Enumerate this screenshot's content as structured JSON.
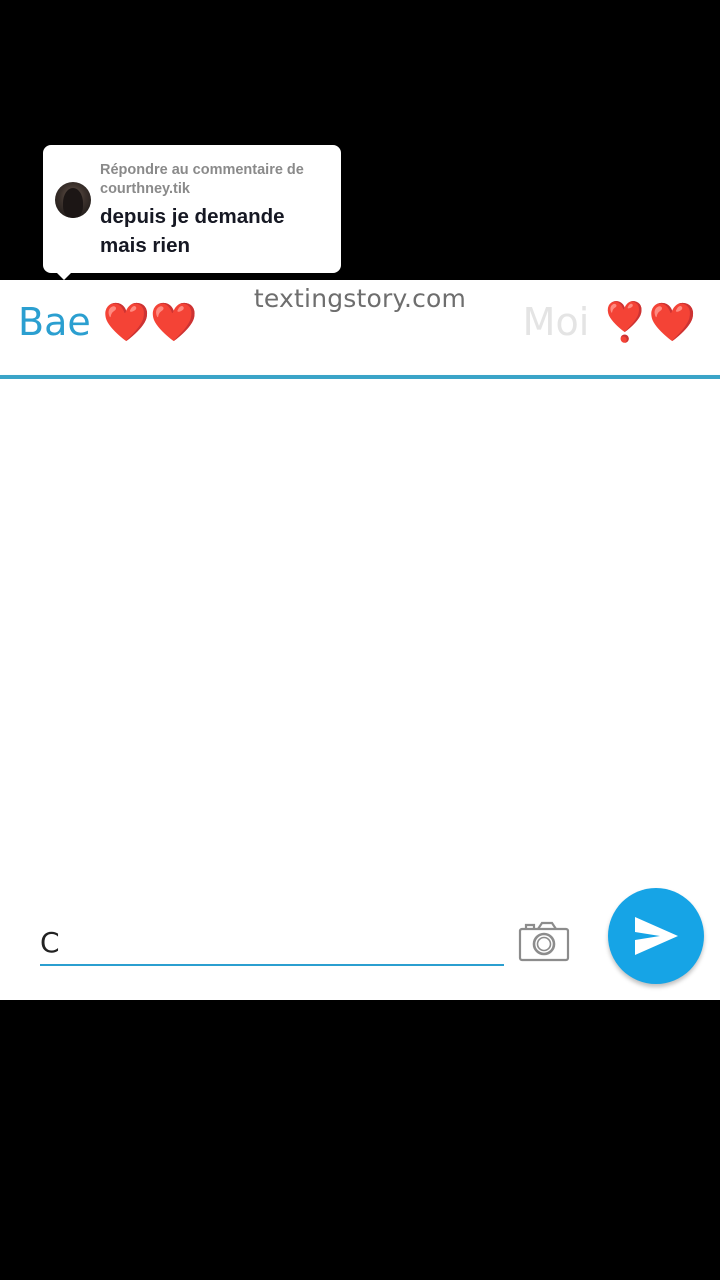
{
  "reply": {
    "header": "Répondre au commentaire de courthney.tik",
    "comment": "depuis je demande mais rien"
  },
  "chat": {
    "watermark": "textingstory.com",
    "contact_left_name": "Bae",
    "contact_left_emoji": "❤️❤️",
    "contact_right_name": "Moi",
    "contact_right_emoji": "❣️❤️",
    "input_value": "C"
  },
  "colors": {
    "accent": "#2b9fd0",
    "send_button": "#16a4e6",
    "heart": "#e0202e"
  },
  "icons": {
    "camera": "camera-icon",
    "send": "send-icon"
  }
}
